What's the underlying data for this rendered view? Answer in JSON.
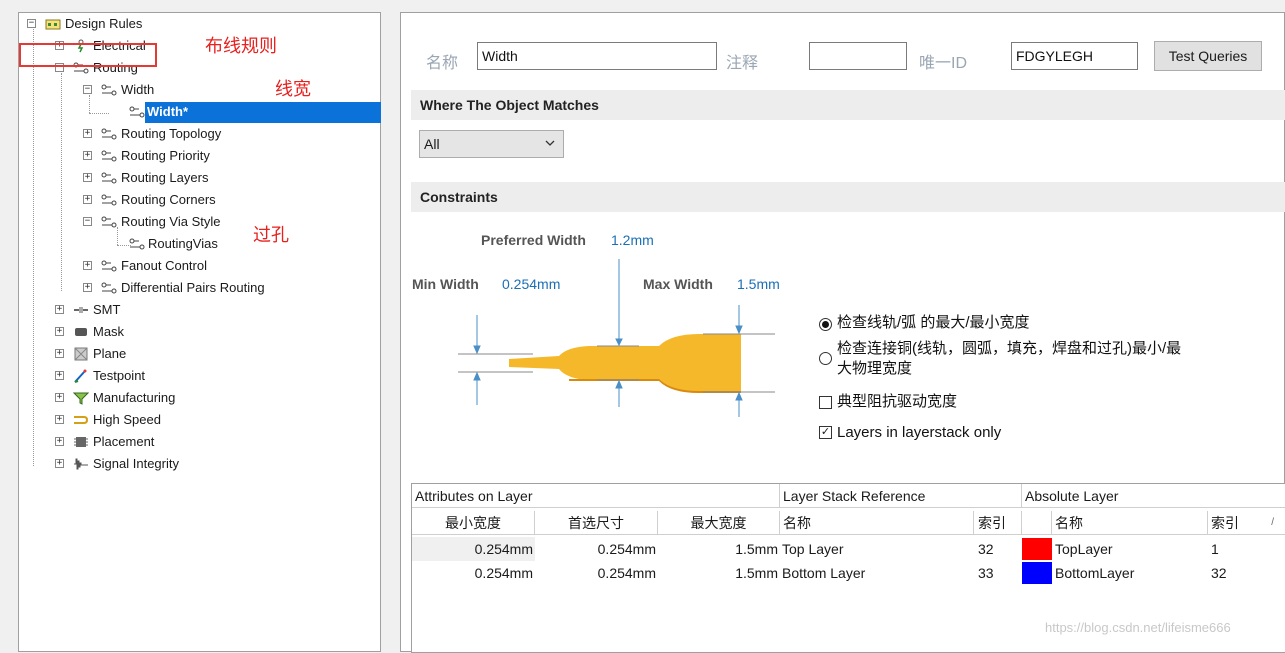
{
  "tree": {
    "root": "Design Rules",
    "electrical": "Electrical",
    "routing": "Routing",
    "width": "Width",
    "width_rule": "Width*",
    "routing_topology": "Routing Topology",
    "routing_priority": "Routing Priority",
    "routing_layers": "Routing Layers",
    "routing_corners": "Routing Corners",
    "routing_via_style": "Routing Via Style",
    "routing_vias": "RoutingVias",
    "fanout_control": "Fanout Control",
    "diff_pairs": "Differential Pairs Routing",
    "smt": "SMT",
    "mask": "Mask",
    "plane": "Plane",
    "testpoint": "Testpoint",
    "manufacturing": "Manufacturing",
    "high_speed": "High Speed",
    "placement": "Placement",
    "signal_integrity": "Signal Integrity"
  },
  "annotations": {
    "routing": "布线规则",
    "width": "线宽",
    "via": "过孔"
  },
  "header": {
    "name_label": "名称",
    "name_value": "Width",
    "comment_label": "注释",
    "comment_value": "",
    "uid_label": "唯一ID",
    "uid_value": "FDGYLEGH",
    "test_queries": "Test Queries"
  },
  "match": {
    "title": "Where The Object Matches",
    "selected": "All"
  },
  "constraints": {
    "title": "Constraints",
    "preferred_label": "Preferred Width",
    "preferred_value": "1.2mm",
    "min_label": "Min Width",
    "min_value": "0.254mm",
    "max_label": "Max Width",
    "max_value": "1.5mm",
    "opt_check_track": "检查线轨/弧 的最大/最小宽度",
    "opt_check_copper_1": "检查连接铜(线轨，圆弧，填充，焊盘和过孔)最小/最",
    "opt_check_copper_2": "大物理宽度",
    "opt_impedance": "典型阻抗驱动宽度",
    "opt_layerstack": "Layers in layerstack only"
  },
  "table": {
    "group_attr": "Attributes on Layer",
    "group_stack": "Layer Stack Reference",
    "group_abs": "Absolute Layer",
    "col_min": "最小宽度",
    "col_pref": "首选尺寸",
    "col_max": "最大宽度",
    "col_name": "名称",
    "col_index": "索引",
    "col_abs_name": "名称",
    "col_abs_index": "索引",
    "rows": [
      {
        "min": "0.254mm",
        "pref": "0.254mm",
        "max": "1.5mm",
        "name": "Top Layer",
        "index": "32",
        "color": "#ff0000",
        "abs_name": "TopLayer",
        "abs_index": "1"
      },
      {
        "min": "0.254mm",
        "pref": "0.254mm",
        "max": "1.5mm",
        "name": "Bottom Layer",
        "index": "33",
        "color": "#0000ff",
        "abs_name": "BottomLayer",
        "abs_index": "32"
      }
    ]
  },
  "watermark": "https://blog.csdn.net/lifeisme666"
}
